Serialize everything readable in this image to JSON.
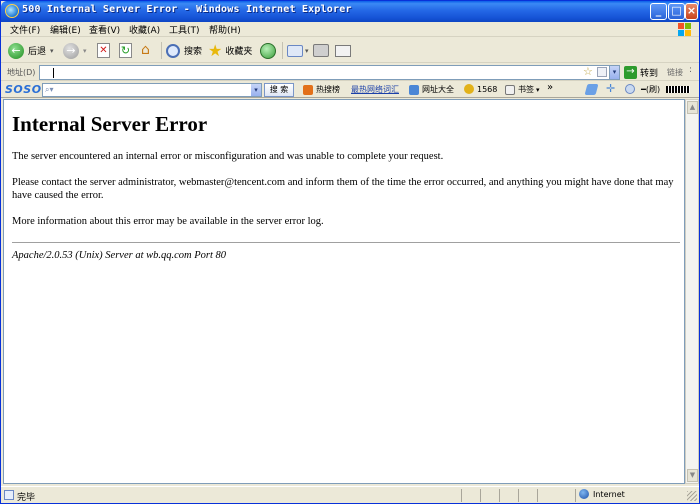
{
  "window": {
    "title": "500 Internal Server Error - Windows Internet Explorer",
    "buttons": [
      "_",
      "□",
      "×"
    ]
  },
  "menu": [
    "文件(F)",
    "编辑(E)",
    "查看(V)",
    "收藏(A)",
    "工具(T)",
    "帮助(H)"
  ],
  "toolbar": {
    "back_label": "后退",
    "search_label": "搜索",
    "favorites_label": "收藏夹"
  },
  "address_bar": {
    "label": "地址(D)",
    "value": "",
    "go_label": "转到",
    "links_label": "链接"
  },
  "soso_bar": {
    "logo": "SOSO",
    "search_button": "搜 索",
    "hot_search": "热搜榜",
    "hot_words": "最热网络词汇",
    "url_directory": "网址大全",
    "count": "1568",
    "bookmarks": "书签",
    "more": "»",
    "tail": "(刷)"
  },
  "page": {
    "title": "Internal Server Error",
    "para1": "The server encountered an internal error or misconfiguration and was unable to complete your request.",
    "para2": "Please contact the server administrator, webmaster@tencent.com and inform them of the time the error occurred, and anything you might have done that may have caused the error.",
    "para3": "More information about this error may be available in the server error log.",
    "server_signature": "Apache/2.0.53 (Unix) Server at wb.qq.com Port 80"
  },
  "status_bar": {
    "status": "完毕",
    "zone": "Internet"
  },
  "colors": {
    "title_bar": "#2468e6",
    "window_frame": "#ece9d8",
    "soso_logo": "#2a6fd6"
  }
}
